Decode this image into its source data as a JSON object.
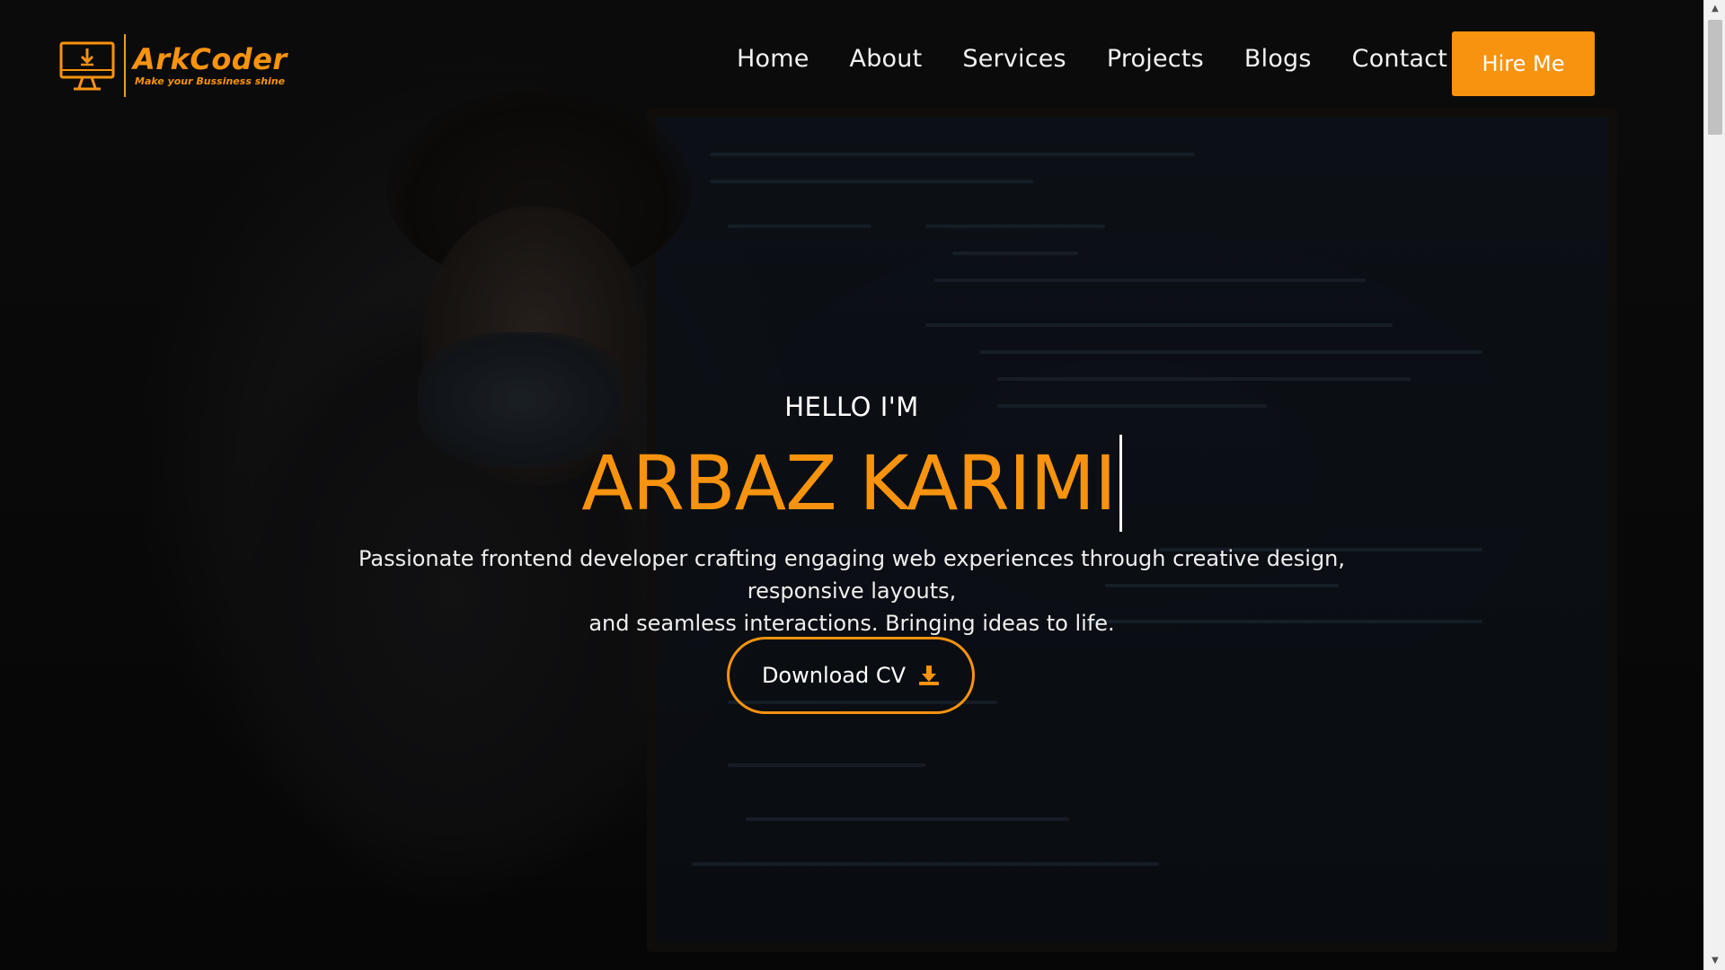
{
  "brand": {
    "name": "ArkCoder",
    "tagline": "Make your Bussiness shine",
    "accent_color": "#f7930e"
  },
  "nav": {
    "items": [
      {
        "label": "Home"
      },
      {
        "label": "About"
      },
      {
        "label": "Services"
      },
      {
        "label": "Projects"
      },
      {
        "label": "Blogs"
      },
      {
        "label": "Contact"
      }
    ],
    "cta_label": "Hire Me"
  },
  "hero": {
    "greeting": "HELLO I'M",
    "name": "ARBAZ KARIMI",
    "description_line1": "Passionate frontend developer crafting engaging web experiences through creative design, responsive layouts,",
    "description_line2": "and seamless interactions. Bringing ideas to life.",
    "cv_button_label": "Download CV",
    "cv_icon": "download-icon",
    "background_image": "developer-pointing-at-code-screen"
  }
}
